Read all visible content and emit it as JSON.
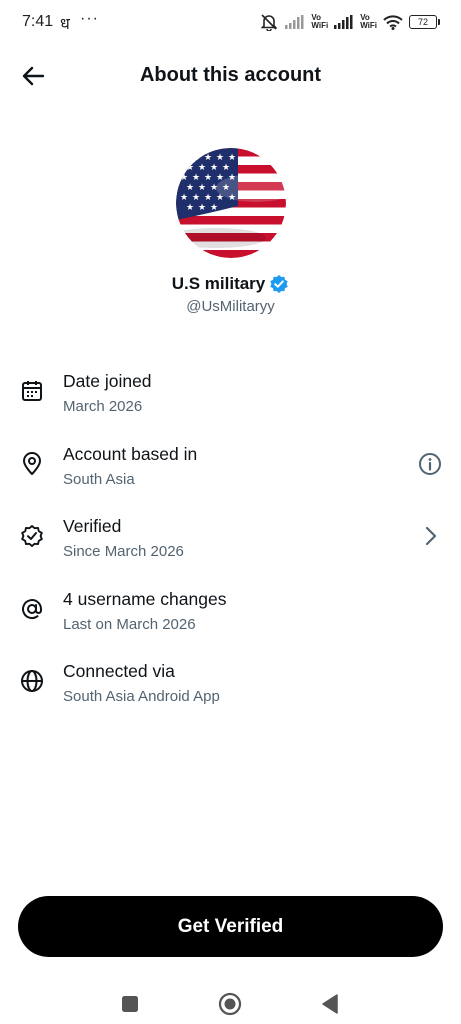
{
  "status_bar": {
    "time": "7:41",
    "extra_glyph": "ध",
    "dots": "···",
    "vo_wifi_label_1": "Vo",
    "vo_wifi_label_2": "WiFi",
    "battery": "72",
    "icons": [
      "mute-icon",
      "signal-icon",
      "vowifi-icon",
      "wifi-icon",
      "battery-icon"
    ]
  },
  "header": {
    "title": "About this account",
    "back_icon": "arrow-left-icon"
  },
  "profile": {
    "display_name": "U.S military",
    "handle": "@UsMilitaryy",
    "verified_badge_color": "#1d9bf0"
  },
  "info_items": [
    {
      "title": "Date joined",
      "subtitle": "March 2026",
      "icon": "calendar-icon"
    },
    {
      "title": "Account based in",
      "subtitle": "South Asia",
      "icon": "location-pin-icon",
      "trailing_icon": "info-icon"
    },
    {
      "title": "Verified",
      "subtitle": "Since March 2026",
      "icon": "verified-badge-icon",
      "trailing_icon": "chevron-right-icon"
    },
    {
      "title": "4 username changes",
      "subtitle": "Last on March 2026",
      "icon": "at-sign-icon"
    },
    {
      "title": "Connected via",
      "subtitle": "South Asia Android App",
      "icon": "globe-icon"
    }
  ],
  "actions": {
    "get_verified": "Get Verified"
  },
  "nav": [
    "recents-square-icon",
    "home-circle-icon",
    "back-triangle-icon"
  ],
  "colors": {
    "text_primary": "#0f1419",
    "text_secondary": "#536471",
    "button_bg": "#000000",
    "verified_blue": "#1d9bf0"
  }
}
